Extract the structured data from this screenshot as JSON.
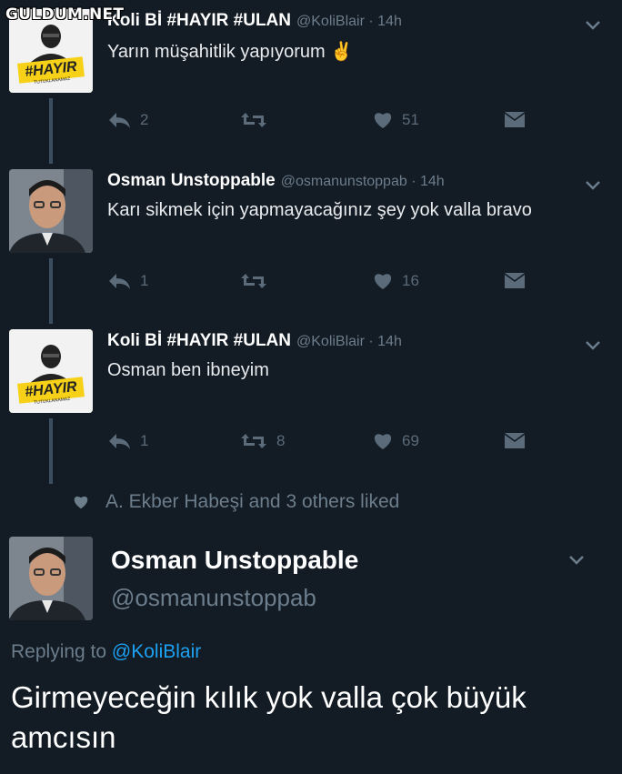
{
  "watermark": "GULDUM.NET",
  "colors": {
    "background": "#131b24",
    "link": "#1da1f2",
    "muted": "#6c7d8c",
    "hayir_yellow": "#f7d117"
  },
  "avatar_hayir": {
    "hashtag": "#HAYIR",
    "subtext": "TUTUKLANAMAZ"
  },
  "tweets": [
    {
      "name": "Koli Bİ #HAYIR #ULAN",
      "handle": "@KoliBlair · 14h",
      "text": "Yarın müşahitlik yapıyorum ✌",
      "replies": "2",
      "retweets": "",
      "likes": "51",
      "avatar": "hayir-avatar"
    },
    {
      "name": "Osman Unstoppable",
      "handle": "@osmanunstoppab · 14h",
      "text": "Karı sikmek için yapmayacağınız şey yok valla bravo",
      "replies": "1",
      "retweets": "",
      "likes": "16",
      "avatar": "man-photo-avatar"
    },
    {
      "name": "Koli Bİ #HAYIR #ULAN",
      "handle": "@KoliBlair · 14h",
      "text": "Osman ben ibneyim",
      "replies": "1",
      "retweets": "8",
      "likes": "69",
      "avatar": "hayir-avatar"
    }
  ],
  "liked_by": "A. Ekber Habeşi and 3 others liked",
  "main_tweet": {
    "name": "Osman Unstoppable",
    "handle": "@osmanunstoppab",
    "replying_prefix": "Replying to ",
    "replying_to": "@KoliBlair",
    "text": "Girmeyeceğin kılık yok valla çok büyük amcısın"
  }
}
